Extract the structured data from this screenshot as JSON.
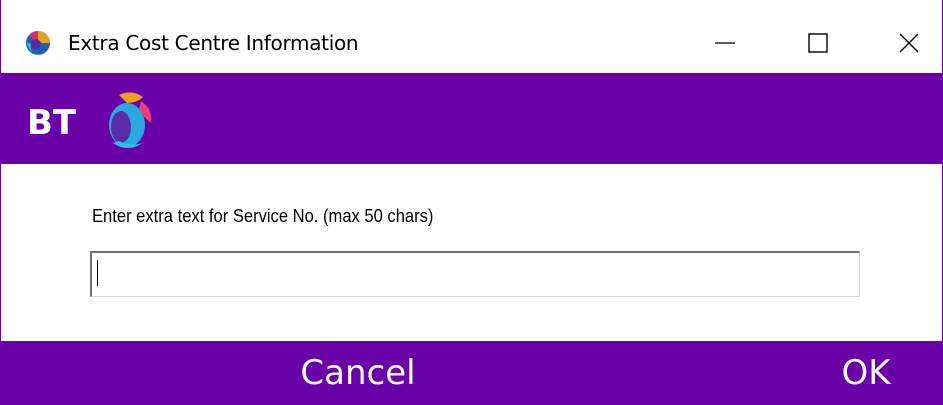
{
  "window": {
    "title": "Extra Cost Centre Information",
    "app_icon": "bt-globe-icon",
    "controls": {
      "minimize_icon": "minimize-icon",
      "maximize_icon": "maximize-icon",
      "close_icon": "close-icon"
    }
  },
  "banner": {
    "logo_text": "BT",
    "background_color": "#6a00a8"
  },
  "form": {
    "prompt": "Enter extra text for Service No. (max 50 chars)",
    "input_value": "",
    "max_length": "50"
  },
  "footer": {
    "cancel_label": "Cancel",
    "ok_label": "OK",
    "background_color": "#6a00a8",
    "text_color": "#ffffff"
  }
}
